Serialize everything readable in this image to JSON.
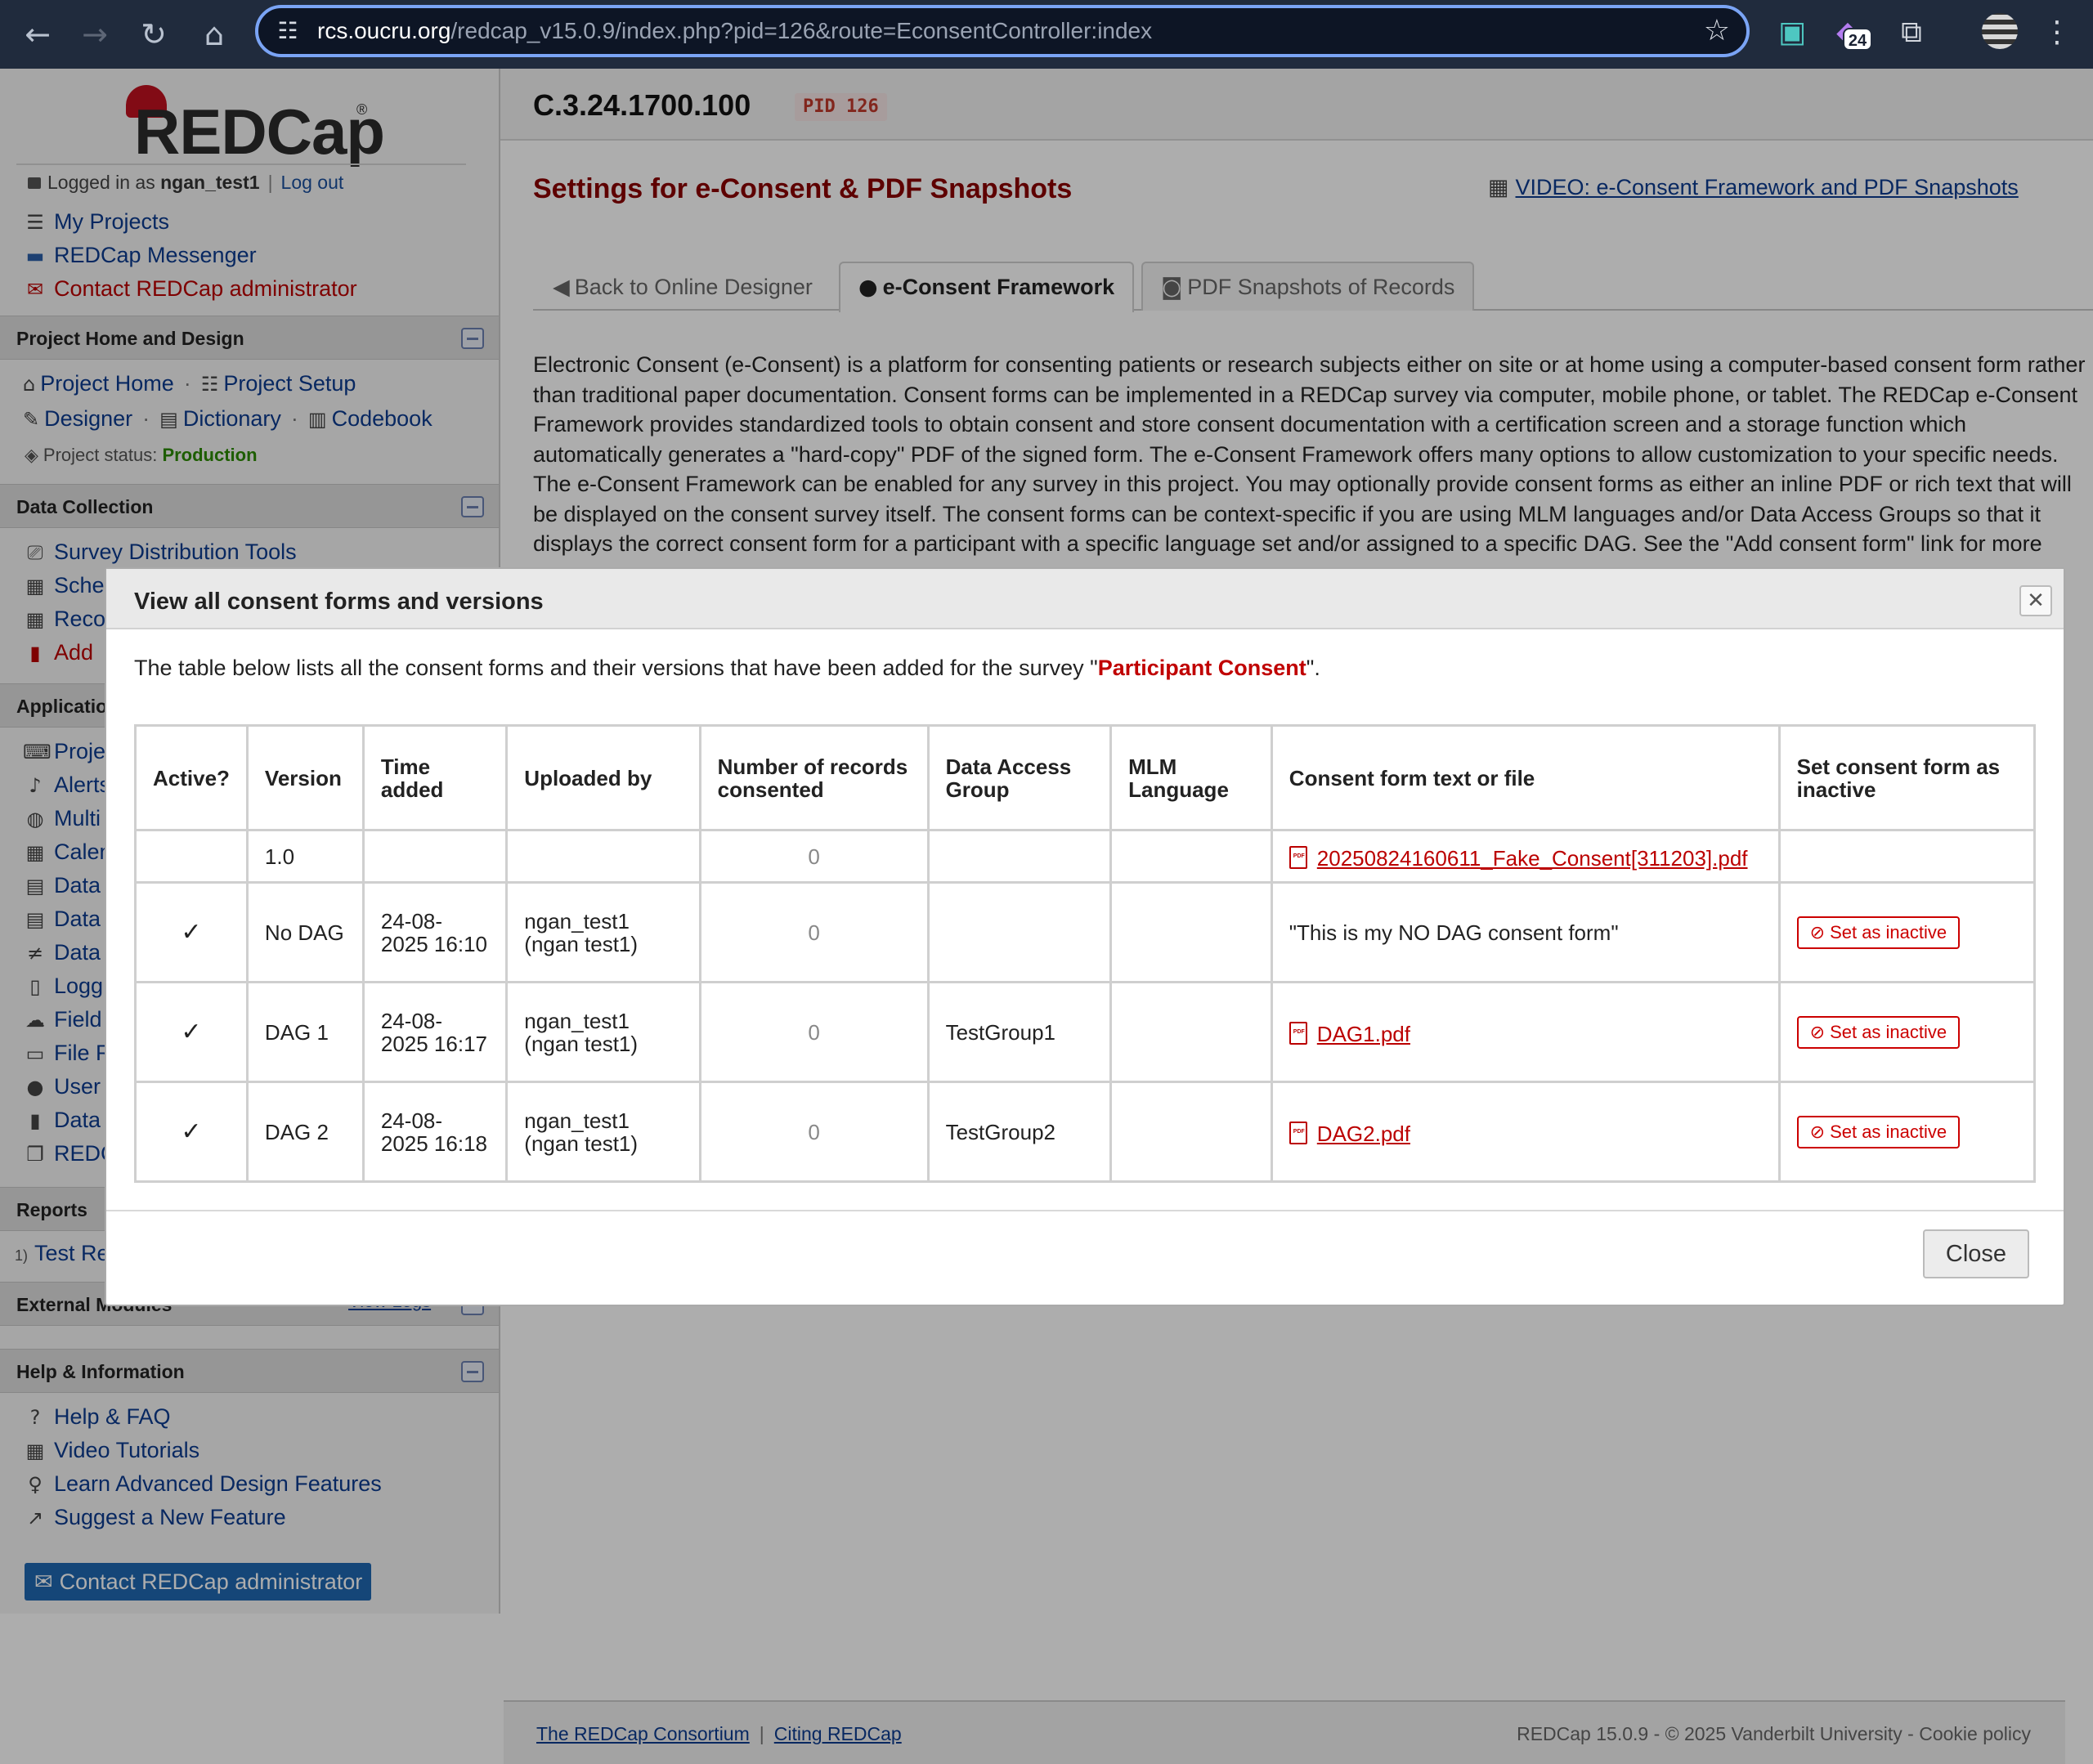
{
  "browser": {
    "url_domain": "rcs.oucru.org",
    "url_path": "/redcap_v15.0.9/index.php?pid=126&route=EconsentController:index",
    "extension_badge": "24"
  },
  "sidebar": {
    "logo_text": "REDCap",
    "logo_reg": "®",
    "logged_in_prefix": "Logged in as",
    "username": "ngan_test1",
    "logout": "Log out",
    "top_links": [
      "My Projects",
      "REDCap Messenger",
      "Contact REDCap administrator"
    ],
    "sections": {
      "home_design": "Project Home and Design",
      "data_collection": "Data Collection",
      "applications": "Applications",
      "reports": "Reports",
      "external_modules": "External Modules",
      "external_modules_link": "View Logs",
      "help": "Help & Information"
    },
    "home_links": [
      "Project Home",
      "Project Setup",
      "Designer",
      "Dictionary",
      "Codebook"
    ],
    "status_label": "Project status:",
    "status_value": "Production",
    "data_collection_links": [
      "Survey Distribution Tools",
      "Sche",
      "Reco",
      "Add"
    ],
    "app_links": [
      "Proje",
      "Alerts",
      "Multi",
      "Calen",
      "Data",
      "Data",
      "Data",
      "Logg",
      "Field",
      "File R",
      "User",
      "Data",
      "REDC"
    ],
    "report_prefix": "1)",
    "report_link": "Test Re",
    "help_links": [
      "Help & FAQ",
      "Video Tutorials",
      "Learn Advanced Design Features",
      "Suggest a New Feature"
    ],
    "contact_button": "Contact REDCap administrator"
  },
  "header": {
    "project_title": "C.3.24.1700.100",
    "pid": "PID 126"
  },
  "main": {
    "page_title": "Settings for e-Consent & PDF Snapshots",
    "video_link": "VIDEO: e-Consent Framework and PDF Snapshots",
    "tabs": [
      {
        "label": "Back to Online Designer"
      },
      {
        "label": "e-Consent Framework"
      },
      {
        "label": "PDF Snapshots of Records"
      }
    ],
    "intro": "Electronic Consent (e-Consent) is a platform for consenting patients or research subjects either on site or at home using a computer-based consent form rather than traditional paper documentation. Consent forms can be implemented in a REDCap survey via computer, mobile phone, or tablet. The REDCap e-Consent Framework provides standardized tools to obtain consent and store consent documentation with a certification screen and a storage function which automatically generates a \"hard-copy\" PDF of the signed form. The e-Consent Framework offers many options to allow customization to your specific needs. The e-Consent Framework can be enabled for any survey in this project. You may optionally provide consent forms as either an inline PDF or rich text that will be displayed on the consent survey itself. The consent forms can be context-specific if you are using MLM languages and/or Data Access Groups so that it displays the correct consent form for a participant with a specific language set and/or assigned to a specific DAG. See the \"Add consent form\" link for more"
  },
  "footer": {
    "consortium": "The REDCap Consortium",
    "citing": "Citing REDCap",
    "version": "REDCap 15.0.9",
    "copyright": "© 2025 Vanderbilt University",
    "cookie": "Cookie policy"
  },
  "dialog": {
    "title": "View all consent forms and versions",
    "desc_prefix": "The table below lists all the consent forms and their versions that have been added for the survey \"",
    "survey_name": "Participant Consent",
    "desc_suffix": "\".",
    "columns": [
      "Active?",
      "Version",
      "Time added",
      "Uploaded by",
      "Number of records consented",
      "Data Access Group",
      "MLM Language",
      "Consent form text or file",
      "Set consent form as inactive"
    ],
    "rows": [
      {
        "active": "",
        "version": "1.0",
        "time": "",
        "uploaded_by": "",
        "records": "0",
        "dag": "",
        "mlm": "",
        "consent_file": "20250824160611_Fake_Consent[311203].pdf",
        "consent_text": "",
        "action": ""
      },
      {
        "active": "✓",
        "version": "No DAG",
        "time": "24-08-2025 16:10",
        "uploaded_by": "ngan_test1 (ngan test1)",
        "records": "0",
        "dag": "",
        "mlm": "",
        "consent_file": "",
        "consent_text": "\"This is my NO DAG consent form\"",
        "action": "Set as inactive"
      },
      {
        "active": "✓",
        "version": "DAG 1",
        "time": "24-08-2025 16:17",
        "uploaded_by": "ngan_test1 (ngan test1)",
        "records": "0",
        "dag": "TestGroup1",
        "mlm": "",
        "consent_file": "DAG1.pdf",
        "consent_text": "",
        "action": "Set as inactive"
      },
      {
        "active": "✓",
        "version": "DAG 2",
        "time": "24-08-2025 16:18",
        "uploaded_by": "ngan_test1 (ngan test1)",
        "records": "0",
        "dag": "TestGroup2",
        "mlm": "",
        "consent_file": "DAG2.pdf",
        "consent_text": "",
        "action": "Set as inactive"
      }
    ],
    "close": "Close"
  }
}
